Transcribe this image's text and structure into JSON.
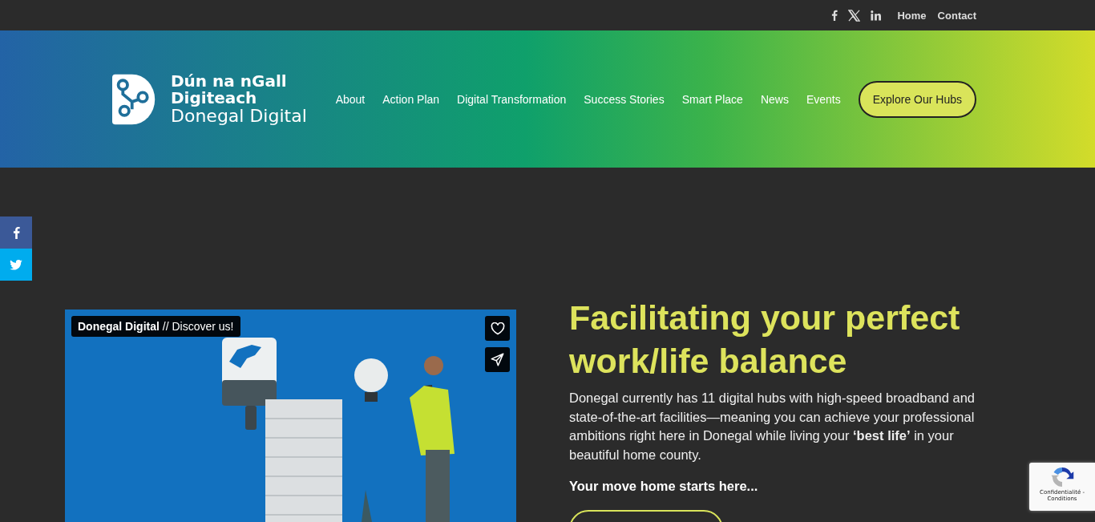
{
  "top_bar": {
    "social": [
      {
        "kind": "facebook"
      },
      {
        "kind": "x"
      },
      {
        "kind": "linkedin"
      }
    ],
    "links": [
      "Home",
      "Contact"
    ]
  },
  "header": {
    "logo": {
      "line_1": "Dún na nGall",
      "line_2": "Digiteach",
      "line_3": "Donegal Digital"
    },
    "nav": [
      "About",
      "Action Plan",
      "Digital Transformation",
      "Success Stories",
      "Smart Place",
      "News",
      "Events"
    ],
    "cta": "Explore Our Hubs"
  },
  "share_sidebar": [
    {
      "kind": "facebook",
      "color": "#3b5998"
    },
    {
      "kind": "twitter",
      "color": "#00acee"
    }
  ],
  "video": {
    "title": "Donegal Digital",
    "subtitle": "// Discover us!",
    "kind": "picture"
  },
  "hero": {
    "heading": "Facilitating your perfect work/life balance",
    "body": "Donegal currently has 11 digital hubs with high-speed broadband and state-of-the-art facilities—meaning you can achieve your professional ambitions right here in Donegal while living your **‘best life’** in your beautiful home county.",
    "tagline": "Your move home starts here..."
  },
  "recaptcha": {
    "terms": "Confidentialité - Conditions"
  }
}
